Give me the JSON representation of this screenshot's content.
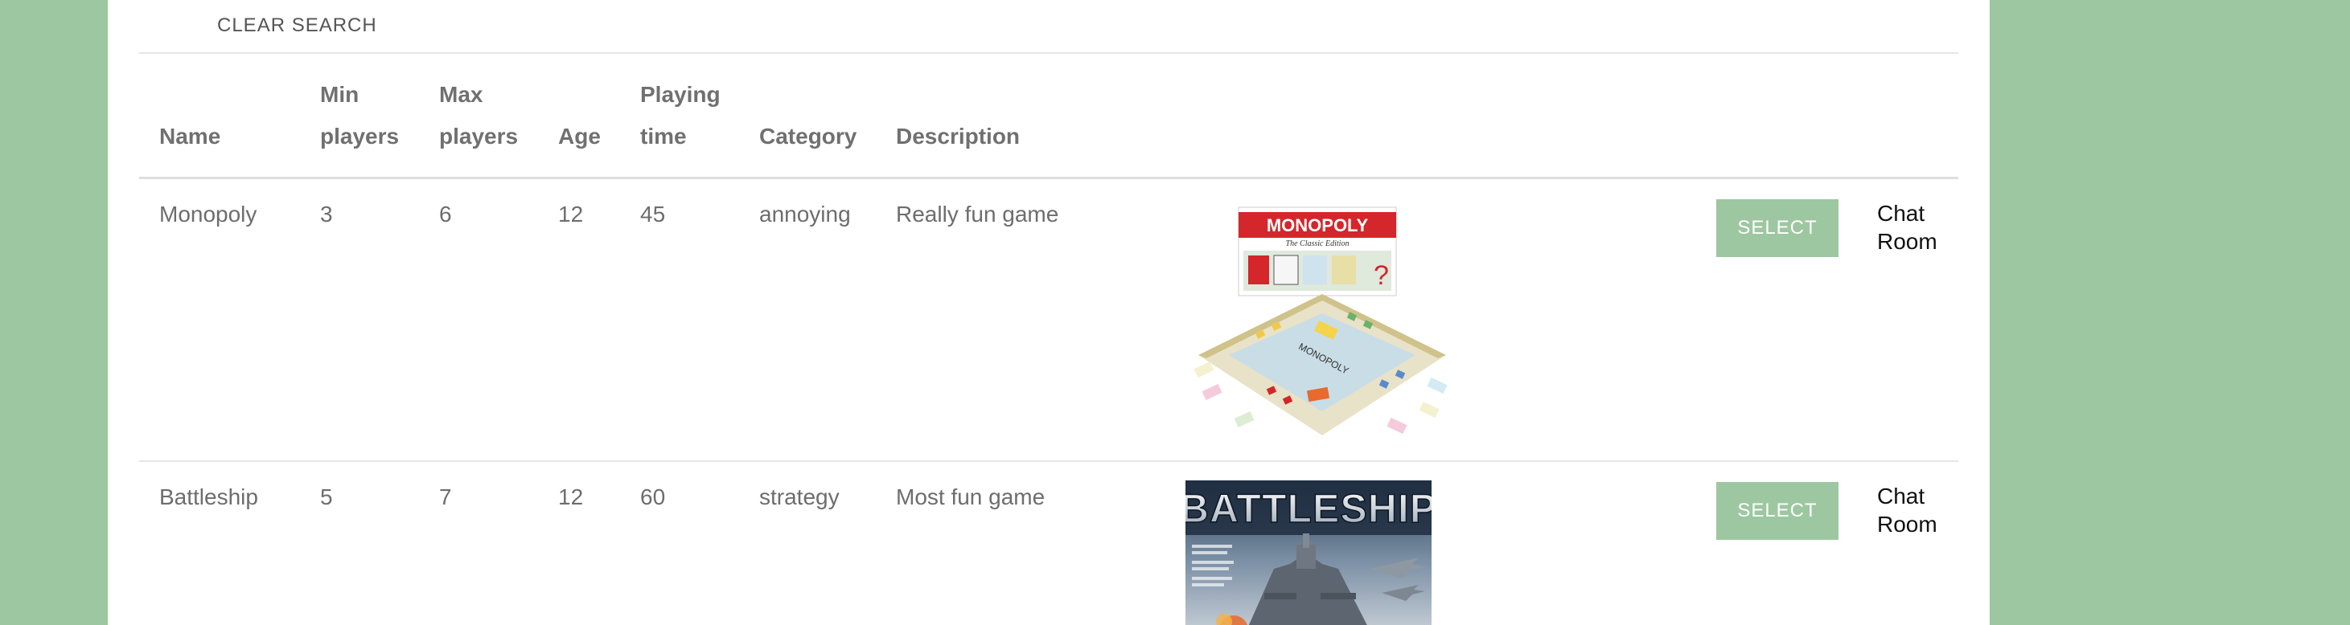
{
  "search": {
    "clear_label": "CLEAR SEARCH"
  },
  "table": {
    "headers": {
      "name": "Name",
      "min_players_line1": "Min",
      "min_players_line2": "players",
      "max_players_line1": "Max",
      "max_players_line2": "players",
      "age": "Age",
      "playing_time_line1": "Playing",
      "playing_time_line2": "time",
      "category": "Category",
      "description": "Description"
    },
    "rows": [
      {
        "name": "Monopoly",
        "min_players": "3",
        "max_players": "6",
        "age": "12",
        "playing_time": "45",
        "category": "annoying",
        "description": "Really fun game",
        "select_label": "SELECT",
        "chat_line1": "Chat",
        "chat_line2": "Room",
        "image": {
          "title": "MONOPOLY",
          "subtitle": "The Classic Edition",
          "board_label": "MONOPOLY"
        }
      },
      {
        "name": "Battleship",
        "min_players": "5",
        "max_players": "7",
        "age": "12",
        "playing_time": "60",
        "category": "strategy",
        "description": "Most fun game",
        "select_label": "SELECT",
        "chat_line1": "Chat",
        "chat_line2": "Room",
        "image": {
          "title": "BATTLESHIP"
        }
      }
    ]
  },
  "colors": {
    "page_background": "#9dc7a0",
    "panel_background": "#ffffff",
    "select_button": "#9dc7a0",
    "header_text": "#707070",
    "cell_text": "#6d6d6d"
  }
}
